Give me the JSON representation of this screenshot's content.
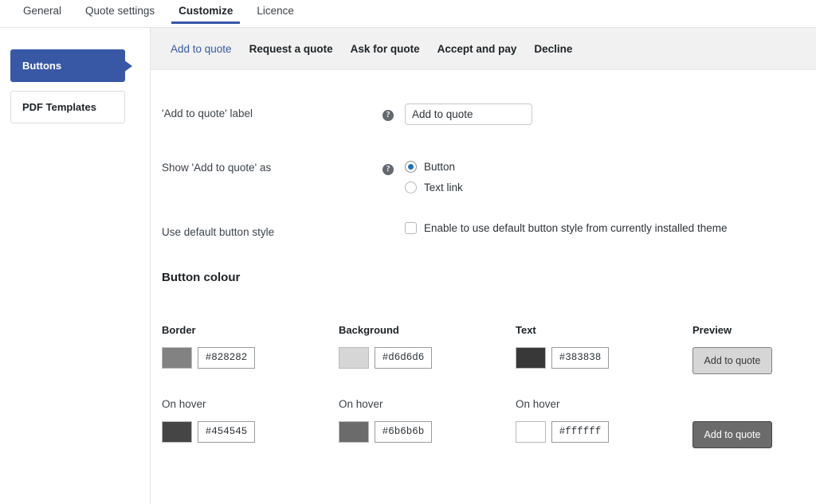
{
  "topnav": {
    "tabs": [
      {
        "label": "General",
        "active": false
      },
      {
        "label": "Quote settings",
        "active": false
      },
      {
        "label": "Customize",
        "active": true
      },
      {
        "label": "Licence",
        "active": false
      }
    ]
  },
  "sidebar": {
    "items": [
      {
        "label": "Buttons",
        "active": true
      },
      {
        "label": "PDF Templates",
        "active": false
      }
    ]
  },
  "subtabs": {
    "items": [
      {
        "label": "Add to quote",
        "active": true
      },
      {
        "label": "Request a quote",
        "active": false
      },
      {
        "label": "Ask for quote",
        "active": false
      },
      {
        "label": "Accept and pay",
        "active": false
      },
      {
        "label": "Decline",
        "active": false
      }
    ]
  },
  "form": {
    "label_row": {
      "label": "'Add to quote' label",
      "help": "?",
      "input_value": "Add to quote",
      "input_placeholder": "Add to quote"
    },
    "show_as_row": {
      "label": "Show 'Add to quote' as",
      "help": "?",
      "options": [
        {
          "label": "Button",
          "checked": true
        },
        {
          "label": "Text link",
          "checked": false
        }
      ]
    },
    "default_style_row": {
      "label": "Use default button style",
      "checkbox_label": "Enable to use default button style from currently installed theme",
      "checked": false
    }
  },
  "button_colour": {
    "title": "Button colour",
    "columns": [
      {
        "head": "Border",
        "hover_head": "On hover"
      },
      {
        "head": "Background",
        "hover_head": "On hover"
      },
      {
        "head": "Text",
        "hover_head": "On hover"
      },
      {
        "head": "Preview",
        "hover_head": ""
      }
    ],
    "normal": {
      "border": {
        "hex": "#828282"
      },
      "background": {
        "hex": "#d6d6d6"
      },
      "text": {
        "hex": "#383838"
      },
      "preview": {
        "label": "Add to quote"
      }
    },
    "hover": {
      "border": {
        "hex": "#454545"
      },
      "background": {
        "hex": "#6b6b6b"
      },
      "text": {
        "hex": "#ffffff"
      },
      "preview": {
        "label": "Add to quote"
      }
    }
  }
}
